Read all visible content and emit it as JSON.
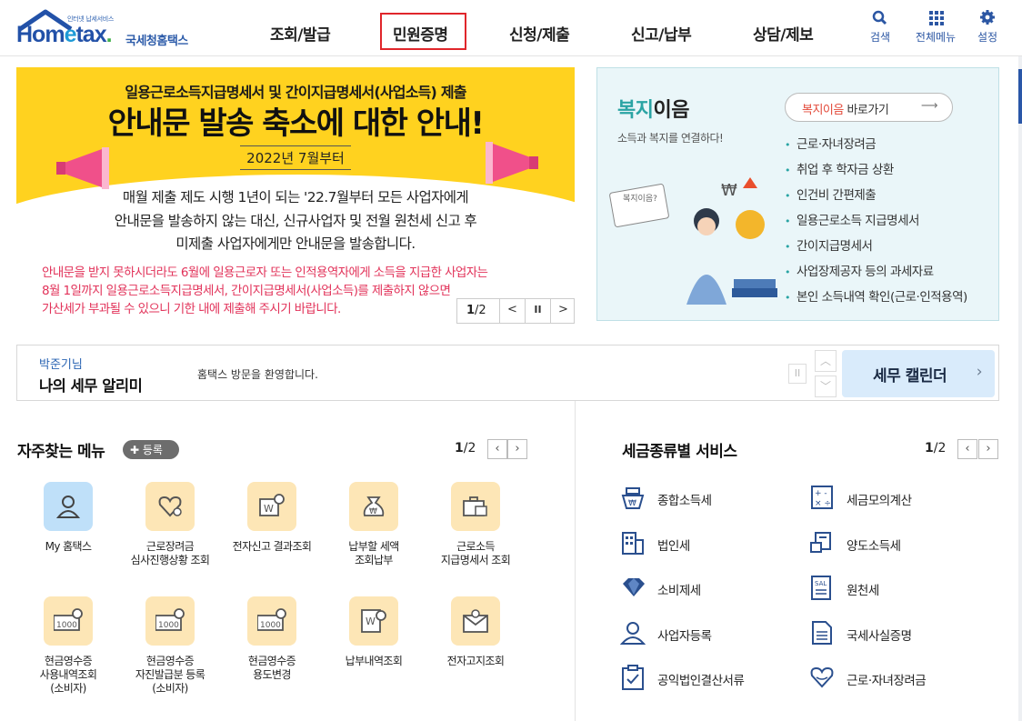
{
  "header": {
    "logo_tagline": "인터넷 납세서비스",
    "logo_word_a": "Hom",
    "logo_word_e": "e",
    "logo_word_b": "tax",
    "logo_dot": ".",
    "logo_name": "국세청홈택스",
    "nav": [
      "조회/발급",
      "민원증명",
      "신청/제출",
      "신고/납부",
      "상담/제보"
    ],
    "highlighted_nav": "민원증명",
    "highlight_color": "#e0262b",
    "util": {
      "search": "검색",
      "all_menu": "전체메뉴",
      "settings": "설정"
    }
  },
  "banner": {
    "subtitle": "일용근로소득지급명세서 및 간이지급명세서(사업소득) 제출",
    "title": "안내문 발송 축소에 대한 안내!",
    "date": "2022년 7월부터",
    "body": [
      "매월 제출 제도 시행 1년이 되는 '22.7월부터 모든 사업자에게",
      "안내문을 발송하지 않는 대신, 신규사업자 및 전월 원천세 신고 후",
      "미제출 사업자에게만 안내문을 발송합니다."
    ],
    "warning": [
      "안내문을 받지 못하시더라도 6월에 일용근로자 또는 인적용역자에게 소득을 지급한 사업자는",
      "8월 1일까지 일용근로소득지급명세서, 간이지급명세서(사업소득)를 제출하지 않으면",
      "가산세가 부과될 수 있으니 기한 내에 제출해 주시기 바랍니다."
    ],
    "page_current": "1",
    "page_total": "/2",
    "prev": "<",
    "pause": "II",
    "next": ">",
    "bg_color": "#ffd21f",
    "warning_color": "#e2335a"
  },
  "welfare": {
    "title_green": "복지",
    "title_rest": "이음",
    "subtitle": "소득과 복지를 연결하다!",
    "link_orange": "복지이음",
    "link_rest": " 바로가기",
    "items": [
      "근로·자녀장려금",
      "취업 후 학자금 상환",
      "인건비 간편제출",
      "일용근로소득 지급명세서",
      "간이지급명세서",
      "사업장제공자 등의 과세자료",
      "본인 소득내역 확인(근로·인적용역)"
    ]
  },
  "alarm": {
    "user": "박준기님",
    "title": "나의 세무 알리미",
    "message": "홈택스 방문을 환영합니다.",
    "calendar": "세무 캘린더"
  },
  "favorites": {
    "title": "자주찾는 메뉴",
    "register": "등록",
    "page_current": "1",
    "page_total": "/2",
    "items": [
      {
        "label": [
          "My 홈택스"
        ],
        "icon": "person-icon"
      },
      {
        "label": [
          "근로장려금",
          "심사진행상황 조회"
        ],
        "icon": "heart-hands-icon"
      },
      {
        "label": [
          "전자신고 결과조회"
        ],
        "icon": "won-search-icon"
      },
      {
        "label": [
          "납부할 세액",
          "조회납부"
        ],
        "icon": "money-bag-icon"
      },
      {
        "label": [
          "근로소득",
          "지급명세서 조회"
        ],
        "icon": "briefcase-won-icon"
      },
      {
        "label": [
          "현금영수증",
          "사용내역조회",
          "(소비자)"
        ],
        "icon": "receipt-1000-icon"
      },
      {
        "label": [
          "현금영수증",
          "자진발급분 등록",
          "(소비자)"
        ],
        "icon": "receipt-1000-icon"
      },
      {
        "label": [
          "현금영수증",
          "용도변경"
        ],
        "icon": "receipt-1000-icon"
      },
      {
        "label": [
          "납부내역조회"
        ],
        "icon": "won-doc-search-icon"
      },
      {
        "label": [
          "전자고지조회"
        ],
        "icon": "email-icon"
      }
    ]
  },
  "tax_services": {
    "title": "세금종류별 서비스",
    "page_current": "1",
    "page_total": "/2",
    "items": [
      {
        "label": "종합소득세",
        "icon": "money-bag-icon"
      },
      {
        "label": "세금모의계산",
        "icon": "calculator-icon"
      },
      {
        "label": "법인세",
        "icon": "building-icon"
      },
      {
        "label": "양도소득세",
        "icon": "truck-doc-icon"
      },
      {
        "label": "소비제세",
        "icon": "diamond-icon"
      },
      {
        "label": "원천세",
        "icon": "salary-doc-icon"
      },
      {
        "label": "사업자등록",
        "icon": "person-card-icon"
      },
      {
        "label": "국세사실증명",
        "icon": "document-icon"
      },
      {
        "label": "공익법인결산서류",
        "icon": "clipboard-icon"
      },
      {
        "label": "근로·자녀장려금",
        "icon": "heart-hands-icon"
      }
    ]
  }
}
